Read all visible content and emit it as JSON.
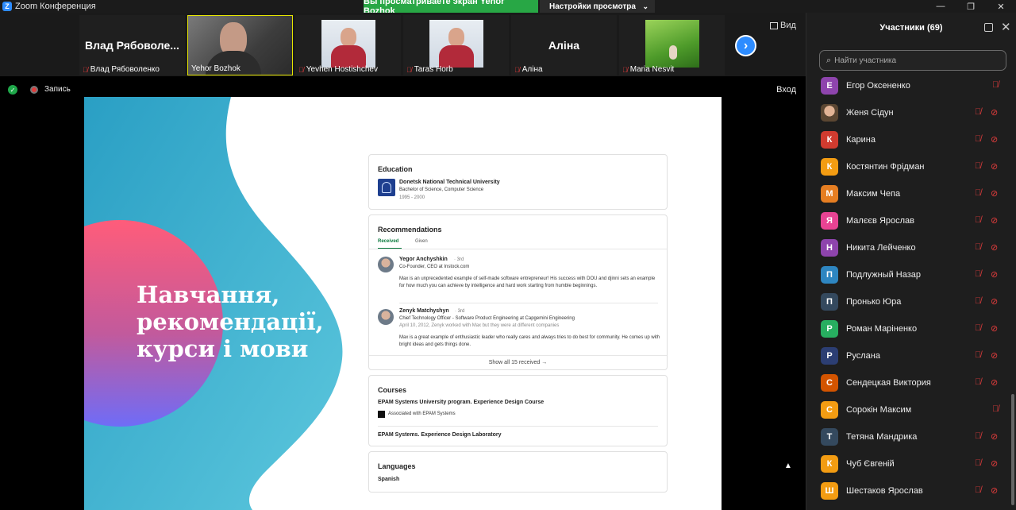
{
  "titlebar": {
    "logo": "Z",
    "app_title": "Zoom Конференция"
  },
  "share_banner": {
    "text": "Вы просматриваете экран Yehor Bozhok"
  },
  "view_settings": {
    "label": "Настройки просмотра",
    "chevron": "chevron-down-icon"
  },
  "window_controls": {
    "minimize": "—",
    "maximize": "❐",
    "close": "✕"
  },
  "video_strip": {
    "tiles": [
      {
        "big_name": "Влад  Рябоволе...",
        "label": "Влад Рябоволенко",
        "muted": true,
        "type": "name"
      },
      {
        "big_name": "",
        "label": "Yehor Bozhok",
        "muted": false,
        "type": "camera",
        "active": true
      },
      {
        "big_name": "",
        "label": "Yevhen Hostishchev",
        "muted": true,
        "type": "photo"
      },
      {
        "big_name": "",
        "label": "Taras Horb",
        "muted": true,
        "type": "photo"
      },
      {
        "big_name": "Аліна",
        "label": "Аліна",
        "muted": true,
        "type": "name"
      },
      {
        "big_name": "",
        "label": "Maria Nesvit",
        "muted": true,
        "type": "nature"
      }
    ],
    "next_icon": "chevron-right-icon",
    "view_label": "Вид"
  },
  "status_row": {
    "record_label": "Запись",
    "enter_label": "Вход"
  },
  "slide": {
    "title_lines": [
      "Навчання,",
      "рекомендації,",
      "курси і мови"
    ],
    "colors": {
      "teal": "#3aa9c9",
      "pink": "#ff5c7a",
      "purple": "#7b6cf6"
    },
    "education": {
      "heading": "Education",
      "university": "Donetsk National Technical University",
      "degree": "Bachelor of Science, Computer Science",
      "years": "1995 - 2000"
    },
    "recommendations": {
      "heading": "Recommendations",
      "tabs": [
        "Received",
        "Given"
      ],
      "items": [
        {
          "name": "Yegor Anchyshkin",
          "degree": "· 3rd",
          "role": "Co-Founder, CEO at Instock.com",
          "meta": "",
          "text": "Max is an unprecedented example of self-made software entrepreneur! His success with DOU and djinni sets an example for how much you can achieve by intelligence and hard work starting from humble beginnings."
        },
        {
          "name": "Zenyk Matchyshyn",
          "degree": "· 3rd",
          "role": "Chief Technology Officer - Software Product Engineering at Capgemini Engineering",
          "meta": "April 10, 2012, Zenyk worked with Max but they were at different companies",
          "text": "Max is a great example of enthusiastic leader who really cares and always tries to do best for community. He comes up with bright ideas and gets things done."
        }
      ],
      "show_all": "Show all 15 received →"
    },
    "courses": {
      "heading": "Courses",
      "course1": "EPAM Systems University program. Experience Design Course",
      "associated": "Associated with EPAM Systems",
      "course2": "EPAM Systems. Experience Design Laboratory"
    },
    "languages": {
      "heading": "Languages",
      "language1": "Spanish"
    }
  },
  "participants": {
    "title": "Участники (69)",
    "search_placeholder": "Найти участника",
    "list": [
      {
        "initial": "Е",
        "name": "Егор Оксененко",
        "color": "#8e44ad",
        "cam_off": false
      },
      {
        "initial": "",
        "name": "Женя Сідун",
        "color": "photo",
        "cam_off": true
      },
      {
        "initial": "К",
        "name": "Карина",
        "color": "#d13b2f",
        "cam_off": true
      },
      {
        "initial": "К",
        "name": "Костянтин Фрідман",
        "color": "#f39c12",
        "cam_off": true
      },
      {
        "initial": "М",
        "name": "Максим Чепа",
        "color": "#e67e22",
        "cam_off": true
      },
      {
        "initial": "Я",
        "name": "Малєєв Ярослав",
        "color": "#e84393",
        "cam_off": true
      },
      {
        "initial": "Н",
        "name": "Никита Лейченко",
        "color": "#8e44ad",
        "cam_off": true
      },
      {
        "initial": "П",
        "name": "Подлужный Назар",
        "color": "#2e86c1",
        "cam_off": true
      },
      {
        "initial": "П",
        "name": "Пронько Юра",
        "color": "#34495e",
        "cam_off": true
      },
      {
        "initial": "Р",
        "name": "Роман Марiненко",
        "color": "#27ae60",
        "cam_off": true
      },
      {
        "initial": "Р",
        "name": "Руслана",
        "color": "#2c3e73",
        "cam_off": true
      },
      {
        "initial": "С",
        "name": "Сендецкая Виктория",
        "color": "#d35400",
        "cam_off": true
      },
      {
        "initial": "С",
        "name": "Сорокін Максим",
        "color": "#f39c12",
        "cam_off": false
      },
      {
        "initial": "Т",
        "name": "Тетяна Мандрика",
        "color": "#34495e",
        "cam_off": true
      },
      {
        "initial": "К",
        "name": "Чуб Євгеній",
        "color": "#f39c12",
        "cam_off": true
      },
      {
        "initial": "Ш",
        "name": "Шестаков Ярослав",
        "color": "#f39c12",
        "cam_off": true
      }
    ]
  }
}
